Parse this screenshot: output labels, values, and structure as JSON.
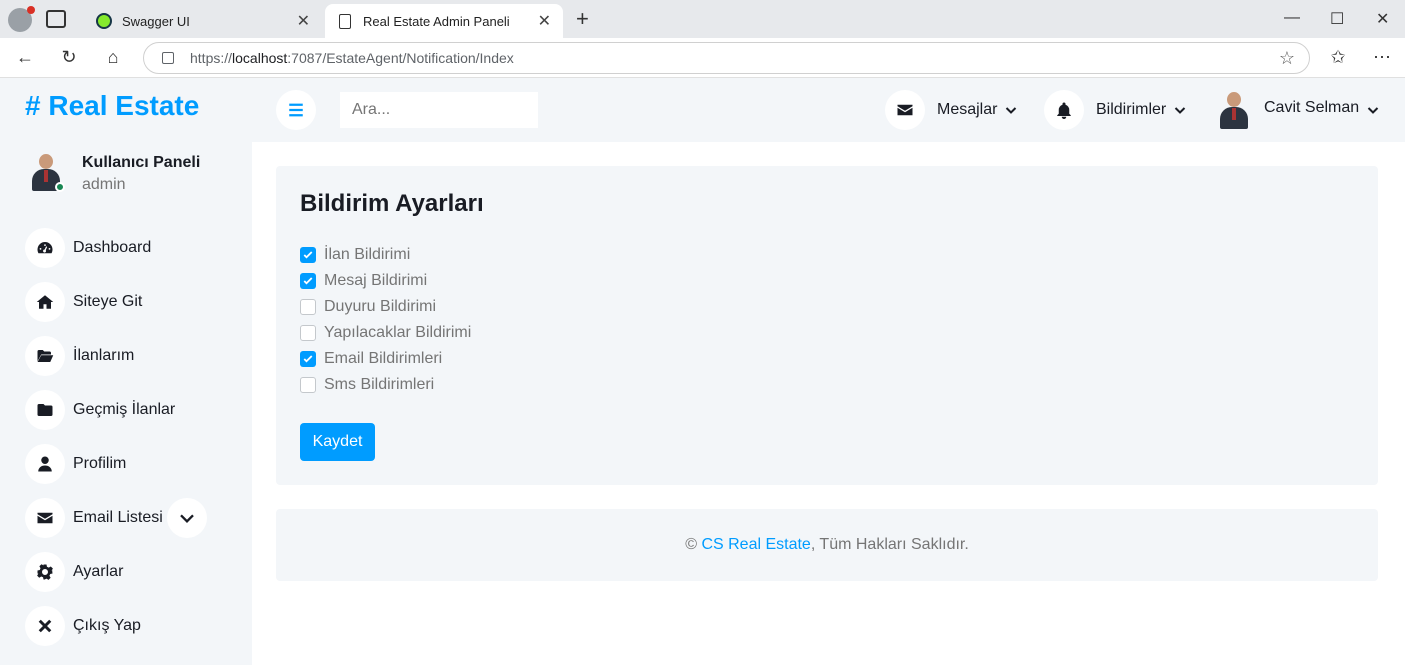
{
  "browser": {
    "tabs": [
      {
        "title": "Swagger UI",
        "active": false
      },
      {
        "title": "Real Estate Admin Paneli",
        "active": true
      }
    ],
    "url_prefix": "https://",
    "url_host": "localhost",
    "url_rest": ":7087/EstateAgent/Notification/Index"
  },
  "brand": {
    "logo": "# Real Estate",
    "accent_color": "#009cff"
  },
  "user": {
    "panel_title": "Kullanıcı Paneli",
    "role": "admin",
    "name": "Cavit Selman"
  },
  "sidebar": {
    "items": [
      {
        "label": "Dashboard",
        "icon": "tachometer-icon"
      },
      {
        "label": "Siteye Git",
        "icon": "home-icon"
      },
      {
        "label": "İlanlarım",
        "icon": "folder-open-icon"
      },
      {
        "label": "Geçmiş İlanlar",
        "icon": "folder-icon"
      },
      {
        "label": "Profilim",
        "icon": "user-icon"
      },
      {
        "label": "Email Listesi",
        "icon": "envelope-icon"
      },
      {
        "label": "Ayarlar",
        "icon": "cog-icon"
      },
      {
        "label": "Çıkış Yap",
        "icon": "times-icon"
      }
    ]
  },
  "topbar": {
    "search_placeholder": "Ara...",
    "messages_label": "Mesajlar",
    "notifications_label": "Bildirimler"
  },
  "settings": {
    "title": "Bildirim Ayarları",
    "options": [
      {
        "label": "İlan Bildirimi",
        "checked": true
      },
      {
        "label": "Mesaj Bildirimi",
        "checked": true
      },
      {
        "label": "Duyuru Bildirimi",
        "checked": false
      },
      {
        "label": "Yapılacaklar Bildirimi",
        "checked": false
      },
      {
        "label": "Email Bildirimleri",
        "checked": true
      },
      {
        "label": "Sms Bildirimleri",
        "checked": false
      }
    ],
    "save_label": "Kaydet"
  },
  "footer": {
    "copyright": "©",
    "company": "CS Real Estate",
    "rights": ", Tüm Hakları Saklıdır."
  }
}
